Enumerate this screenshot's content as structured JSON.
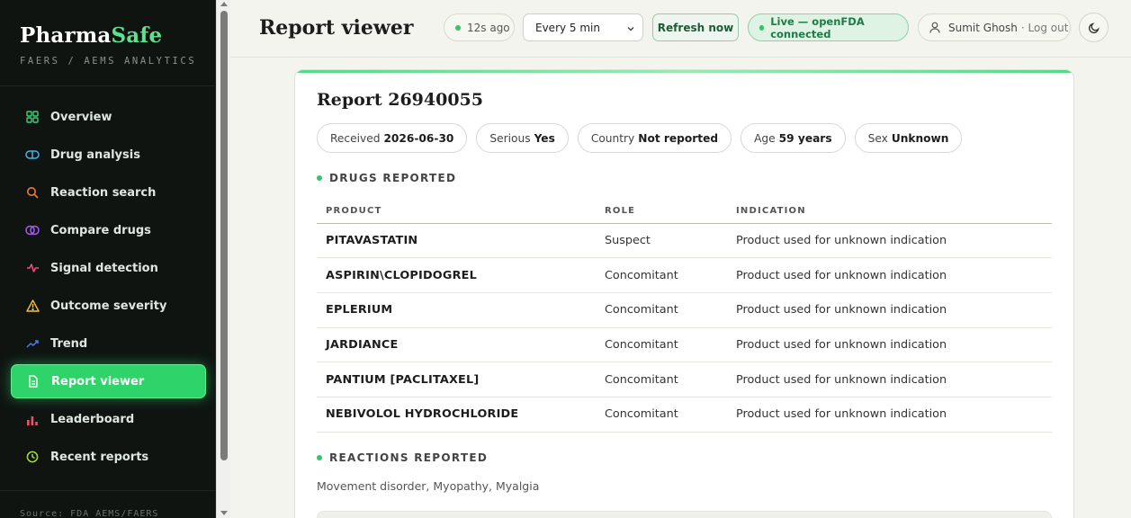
{
  "brand": {
    "name_main": "Pharma",
    "name_accent": "Safe",
    "subtitle": "FAERS / AEMS ANALYTICS"
  },
  "nav": [
    {
      "label": "Overview",
      "icon": "grid-icon",
      "color": "#3ad07c"
    },
    {
      "label": "Drug analysis",
      "icon": "pill-icon",
      "color": "#3cb6e6"
    },
    {
      "label": "Reaction search",
      "icon": "search-icon",
      "color": "#f07a32"
    },
    {
      "label": "Compare drugs",
      "icon": "compare-icon",
      "color": "#a35df0"
    },
    {
      "label": "Signal detection",
      "icon": "pulse-icon",
      "color": "#f0508a"
    },
    {
      "label": "Outcome severity",
      "icon": "warning-icon",
      "color": "#f0c43a"
    },
    {
      "label": "Trend",
      "icon": "trend-icon",
      "color": "#4a7cf0"
    },
    {
      "label": "Report viewer",
      "icon": "document-icon",
      "color": "#ffffff",
      "active": true
    },
    {
      "label": "Leaderboard",
      "icon": "bar-chart-icon",
      "color": "#f0506a"
    },
    {
      "label": "Recent reports",
      "icon": "clock-icon",
      "color": "#a8d83a"
    }
  ],
  "source_note": "Source: FDA AEMS/FAERS",
  "header": {
    "title": "Report viewer",
    "updated_ago": "12s ago",
    "interval_selected": "Every 5 min",
    "refresh_label": "Refresh now",
    "status_label": "Live — openFDA connected",
    "user_name": "Sumit Ghosh",
    "logout_label": "· Log out"
  },
  "report": {
    "title": "Report 26940055",
    "meta": [
      {
        "label": "Received",
        "value": "2026-06-30"
      },
      {
        "label": "Serious",
        "value": "Yes"
      },
      {
        "label": "Country",
        "value": "Not reported"
      },
      {
        "label": "Age",
        "value": "59 years"
      },
      {
        "label": "Sex",
        "value": "Unknown"
      }
    ],
    "drugs_heading": "DRUGS REPORTED",
    "columns": [
      "PRODUCT",
      "ROLE",
      "INDICATION"
    ],
    "drugs": [
      {
        "product": "PITAVASTATIN",
        "role": "Suspect",
        "indication": "Product used for unknown indication"
      },
      {
        "product": "ASPIRIN\\CLOPIDOGREL",
        "role": "Concomitant",
        "indication": "Product used for unknown indication"
      },
      {
        "product": "EPLERIUM",
        "role": "Concomitant",
        "indication": "Product used for unknown indication"
      },
      {
        "product": "JARDIANCE",
        "role": "Concomitant",
        "indication": "Product used for unknown indication"
      },
      {
        "product": "PANTIUM [PACLITAXEL]",
        "role": "Concomitant",
        "indication": "Product used for unknown indication"
      },
      {
        "product": "NEBIVOLOL HYDROCHLORIDE",
        "role": "Concomitant",
        "indication": "Product used for unknown indication"
      }
    ],
    "reactions_heading": "REACTIONS REPORTED",
    "reactions": "Movement disorder, Myopathy, Myalgia"
  }
}
